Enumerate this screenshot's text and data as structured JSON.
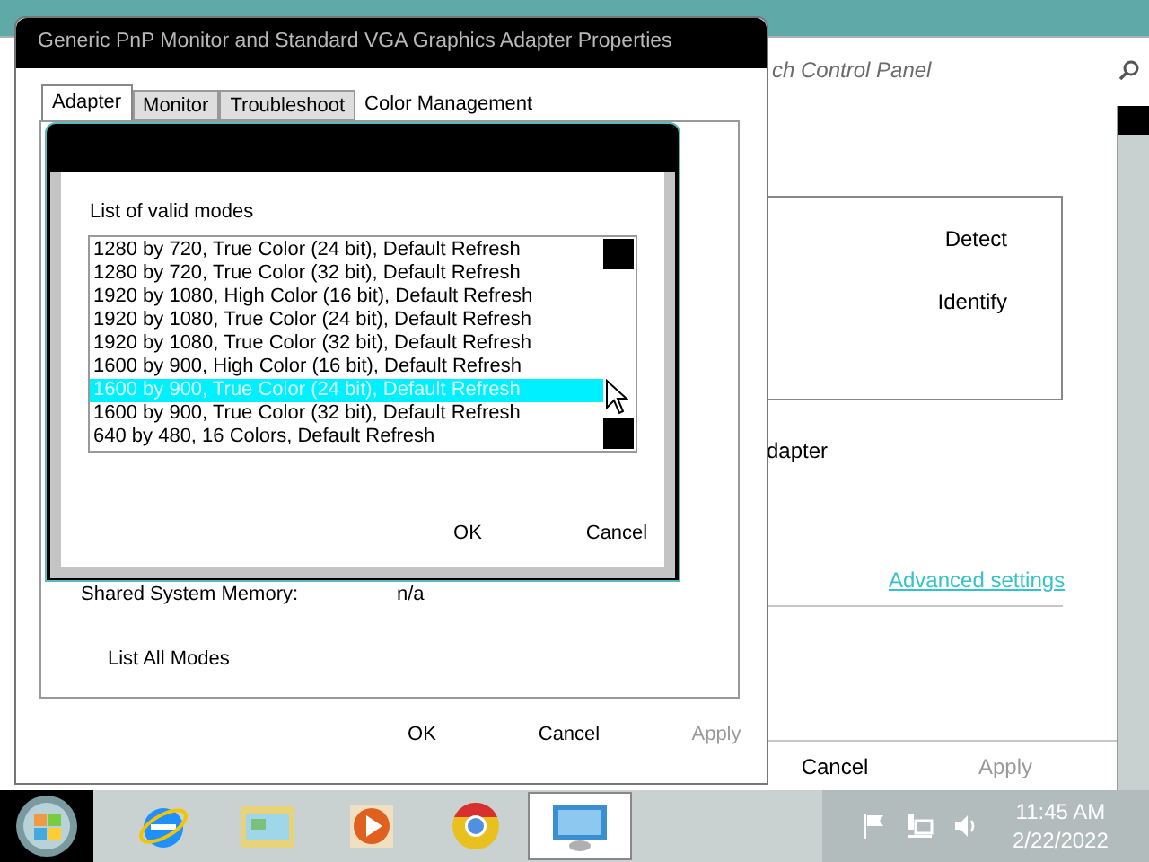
{
  "background_window": {
    "search": {
      "placeholder": "ch Control Panel"
    },
    "buttons": [
      "Detect",
      "Identify"
    ],
    "partial_text": "dapter",
    "link": "Advanced settings",
    "footer_buttons": [
      {
        "label": "Cancel",
        "disabled": false
      },
      {
        "label": "Apply",
        "disabled": true
      }
    ]
  },
  "dialog": {
    "title": "Generic PnP Monitor and Standard VGA Graphics Adapter Properties",
    "tabs": [
      {
        "label": "Adapter",
        "selected": true
      },
      {
        "label": "Monitor",
        "selected": false
      },
      {
        "label": "Troubleshoot",
        "selected": false
      },
      {
        "label": "Color Management",
        "selected": false
      }
    ],
    "fields": [
      {
        "label": "Shared System Memory:",
        "value": "n/a"
      }
    ],
    "list_all_modes": "List All Modes",
    "buttons": [
      {
        "label": "OK",
        "disabled": false
      },
      {
        "label": "Cancel",
        "disabled": false
      },
      {
        "label": "Apply",
        "disabled": true
      }
    ]
  },
  "modes_dialog": {
    "heading": "List of valid modes",
    "modes": [
      {
        "label": "1280 by 720, True Color (24 bit), Default Refresh",
        "selected": false
      },
      {
        "label": "1280 by 720, True Color (32 bit), Default Refresh",
        "selected": false
      },
      {
        "label": "1920 by 1080, High Color (16 bit), Default Refresh",
        "selected": false
      },
      {
        "label": "1920 by 1080, True Color (24 bit), Default Refresh",
        "selected": false
      },
      {
        "label": "1920 by 1080, True Color (32 bit), Default Refresh",
        "selected": false
      },
      {
        "label": "1600 by 900, High Color (16 bit), Default Refresh",
        "selected": false
      },
      {
        "label": "1600 by 900, True Color (24 bit), Default Refresh",
        "selected": true
      },
      {
        "label": "1600 by 900, True Color (32 bit), Default Refresh",
        "selected": false
      },
      {
        "label": "640 by 480, 16 Colors, Default Refresh",
        "selected": false
      }
    ],
    "buttons": [
      "OK",
      "Cancel"
    ]
  },
  "taskbar": {
    "apps": [
      {
        "kind": "browser",
        "selected": false
      },
      {
        "kind": "folder",
        "selected": false
      },
      {
        "kind": "media",
        "selected": false
      },
      {
        "kind": "chrome",
        "selected": false
      },
      {
        "kind": "display",
        "selected": true
      }
    ],
    "clock": {
      "time": "11:45 AM",
      "date": "2/22/2022"
    }
  }
}
